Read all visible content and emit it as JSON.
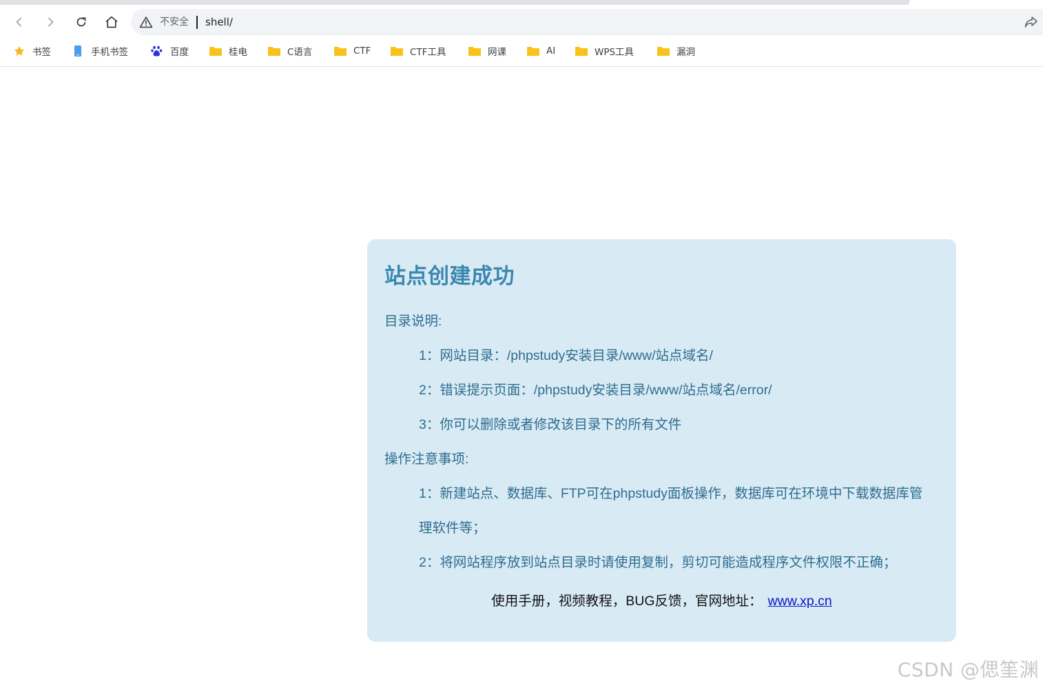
{
  "browser": {
    "address_bar": {
      "security_label": "不安全",
      "url": "shell/"
    },
    "nav_icons": [
      "back-icon",
      "forward-icon",
      "reload-icon",
      "home-icon"
    ],
    "bookmarks": [
      {
        "label": "书签",
        "icon": "star-icon"
      },
      {
        "label": "手机书签",
        "icon": "phone-icon"
      },
      {
        "label": "百度",
        "icon": "baidu-paw-icon"
      },
      {
        "label": "桂电",
        "icon": "folder-icon"
      },
      {
        "label": "C语言",
        "icon": "folder-icon"
      },
      {
        "label": "CTF",
        "icon": "folder-icon"
      },
      {
        "label": "CTF工具",
        "icon": "folder-icon"
      },
      {
        "label": "网课",
        "icon": "folder-icon"
      },
      {
        "label": "AI",
        "icon": "folder-icon"
      },
      {
        "label": "WPS工具",
        "icon": "folder-icon"
      },
      {
        "label": "漏洞",
        "icon": "folder-icon"
      }
    ]
  },
  "page": {
    "title": "站点创建成功",
    "dir_heading": "目录说明:",
    "dir_items": [
      "1：网站目录：/phpstudy安装目录/www/站点域名/",
      "2：错误提示页面：/phpstudy安装目录/www/站点域名/error/",
      "3：你可以删除或者修改该目录下的所有文件"
    ],
    "notes_heading": "操作注意事项:",
    "note_1_line1": "1：新建站点、数据库、FTP可在phpstudy面板操作，数据库可在环境中下载数据库管",
    "note_1_line2": "理软件等；",
    "note_2": "2：将网站程序放到站点目录时请使用复制，剪切可能造成程序文件权限不正确；",
    "footer_text": "使用手册，视频教程，BUG反馈，官网地址：",
    "footer_link": "www.xp.cn"
  },
  "watermark": "CSDN @偲筀渊",
  "colors": {
    "card_bg": "#d8ebf5",
    "title": "#3b87b0",
    "body_text": "#2f6d8e",
    "link": "#0a14c8",
    "folder": "#f9c21b"
  }
}
